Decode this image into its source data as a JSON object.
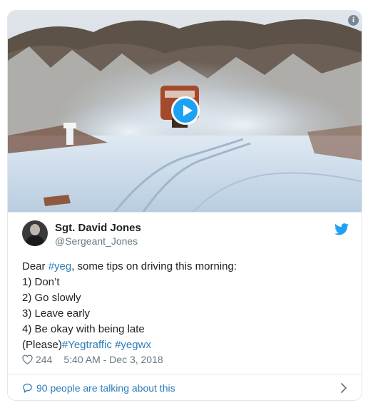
{
  "tweet": {
    "author_name": "Sgt. David Jones",
    "author_handle": "@Sergeant_Jones",
    "text_line1_prefix": "Dear ",
    "text_line1_tag": "#yeg",
    "text_line1_suffix": ", some tips on driving this morning:",
    "text_line2": "1) Don’t",
    "text_line3": "2) Go slowly",
    "text_line4": "3) Leave early",
    "text_line5": "4) Be okay with being late",
    "text_line6_prefix": "(Please)",
    "text_line6_tag1": "#Yegtraffic",
    "text_line6_tag2": "#yegwx",
    "likes": "244",
    "timestamp": "5:40 AM - Dec 3, 2018",
    "talking": "90 people are talking about this"
  },
  "icons": {
    "info": "info-icon",
    "play": "play-icon",
    "brand": "twitter-bird-icon",
    "like": "heart-icon",
    "reply": "speech-bubble-icon",
    "more": "chevron-right-icon"
  },
  "colors": {
    "link": "#2b7bb9",
    "brand": "#1da1f2",
    "muted": "#697882",
    "border": "#e1e8ed"
  }
}
